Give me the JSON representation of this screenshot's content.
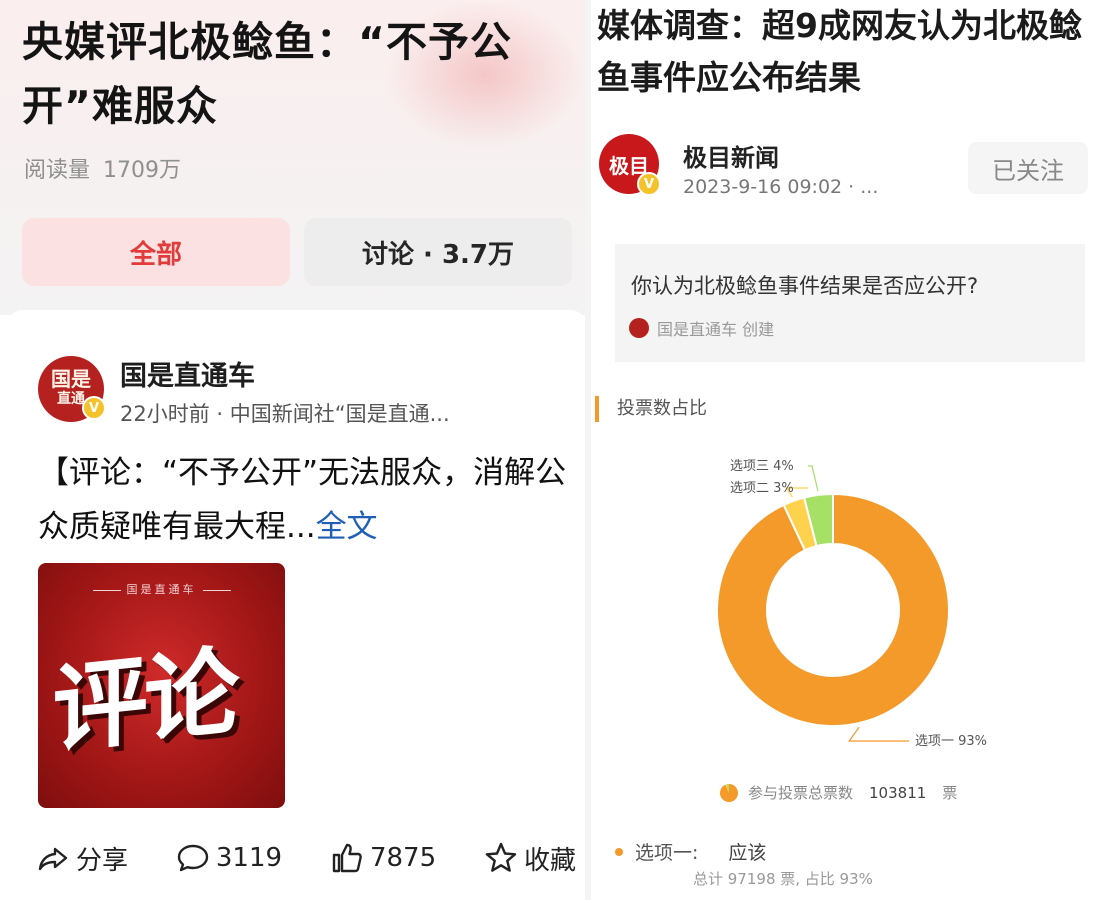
{
  "left": {
    "topic": {
      "title": "央媒评北极鲶鱼：“不予公开”难服众",
      "read_label": "阅读量",
      "read_value": "1709万"
    },
    "tabs": {
      "all": "全部",
      "discussion": "讨论 · 3.7万"
    },
    "post": {
      "avatar_text_top": "国是",
      "avatar_text_bottom": "直通",
      "author": "国是直通车",
      "meta": "22小时前 · 中国新闻社“国是直通...",
      "text": "【评论：“不予公开”无法服众，消解公众质疑唯有最大程...",
      "more": "全文",
      "cover_brand": "国是直通车",
      "cover_big": "评论"
    },
    "actions": {
      "share": "分享",
      "comments": "3119",
      "likes": "7875",
      "favorite": "收藏"
    }
  },
  "right": {
    "article_title": "媒体调查：超9成网友认为北极鲶鱼事件应公布结果",
    "author": {
      "avatar_text": "极目",
      "name": "极目新闻",
      "meta": "2023-9-16 09:02 · ...",
      "follow_label": "已关注"
    },
    "poll": {
      "question": "你认为北极鲶鱼事件结果是否应公开?",
      "creator": "国是直通车 创建",
      "section_label": "投票数占比",
      "total_label": "参与投票总票数",
      "total_value": "103811",
      "total_unit": "票",
      "option1_label": "选项一:",
      "option1_answer": "应该",
      "option1_detail": "总计 97198 票, 占比 93%"
    }
  },
  "chart_data": {
    "type": "pie",
    "donut": true,
    "categories": [
      "选项一",
      "选项二",
      "选项三"
    ],
    "values": [
      93,
      3,
      4
    ],
    "labels": [
      "选项一 93%",
      "选项二 3%",
      "选项三 4%"
    ],
    "colors": [
      "#f39a2b",
      "#ffd24d",
      "#a6e065"
    ],
    "title": "",
    "legend": "none"
  }
}
